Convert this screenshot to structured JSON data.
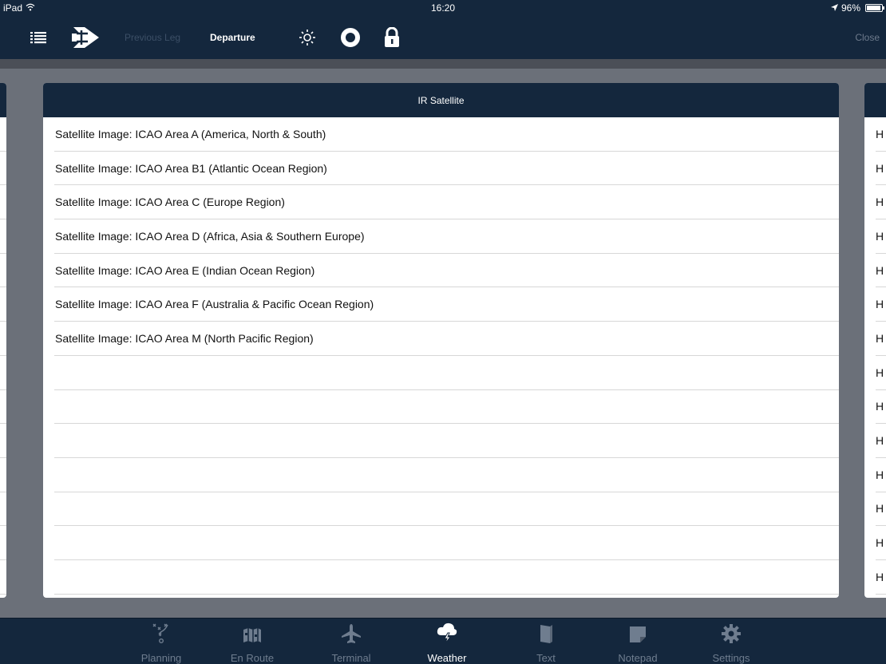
{
  "status": {
    "device": "iPad",
    "time": "16:20",
    "battery": "96%"
  },
  "toolbar": {
    "previous_leg": "Previous Leg",
    "departure": "Departure",
    "close": "Close"
  },
  "panel": {
    "title": "IR Satellite",
    "items": [
      "Satellite Image: ICAO Area A (America, North & South)",
      "Satellite Image: ICAO Area B1 (Atlantic Ocean Region)",
      "Satellite Image: ICAO Area C (Europe Region)",
      "Satellite Image: ICAO Area D (Africa, Asia & Southern Europe)",
      "Satellite Image: ICAO Area E (Indian Ocean Region)",
      "Satellite Image: ICAO Area F (Australia & Pacific Ocean Region)",
      "Satellite Image: ICAO Area M (North Pacific Region)"
    ]
  },
  "right_panel": {
    "row_letter": "H"
  },
  "tabs": [
    {
      "label": "Planning",
      "icon": "planning-icon"
    },
    {
      "label": "En Route",
      "icon": "map-icon"
    },
    {
      "label": "Terminal",
      "icon": "airplane-icon"
    },
    {
      "label": "Weather",
      "icon": "weather-icon"
    },
    {
      "label": "Text",
      "icon": "book-icon"
    },
    {
      "label": "Notepad",
      "icon": "notepad-icon"
    },
    {
      "label": "Settings",
      "icon": "gear-icon"
    }
  ],
  "active_tab": "Weather",
  "colors": {
    "nav_bg": "#14273d",
    "background": "#6b7079",
    "active": "#ffffff",
    "inactive": "#6f7d8f"
  }
}
